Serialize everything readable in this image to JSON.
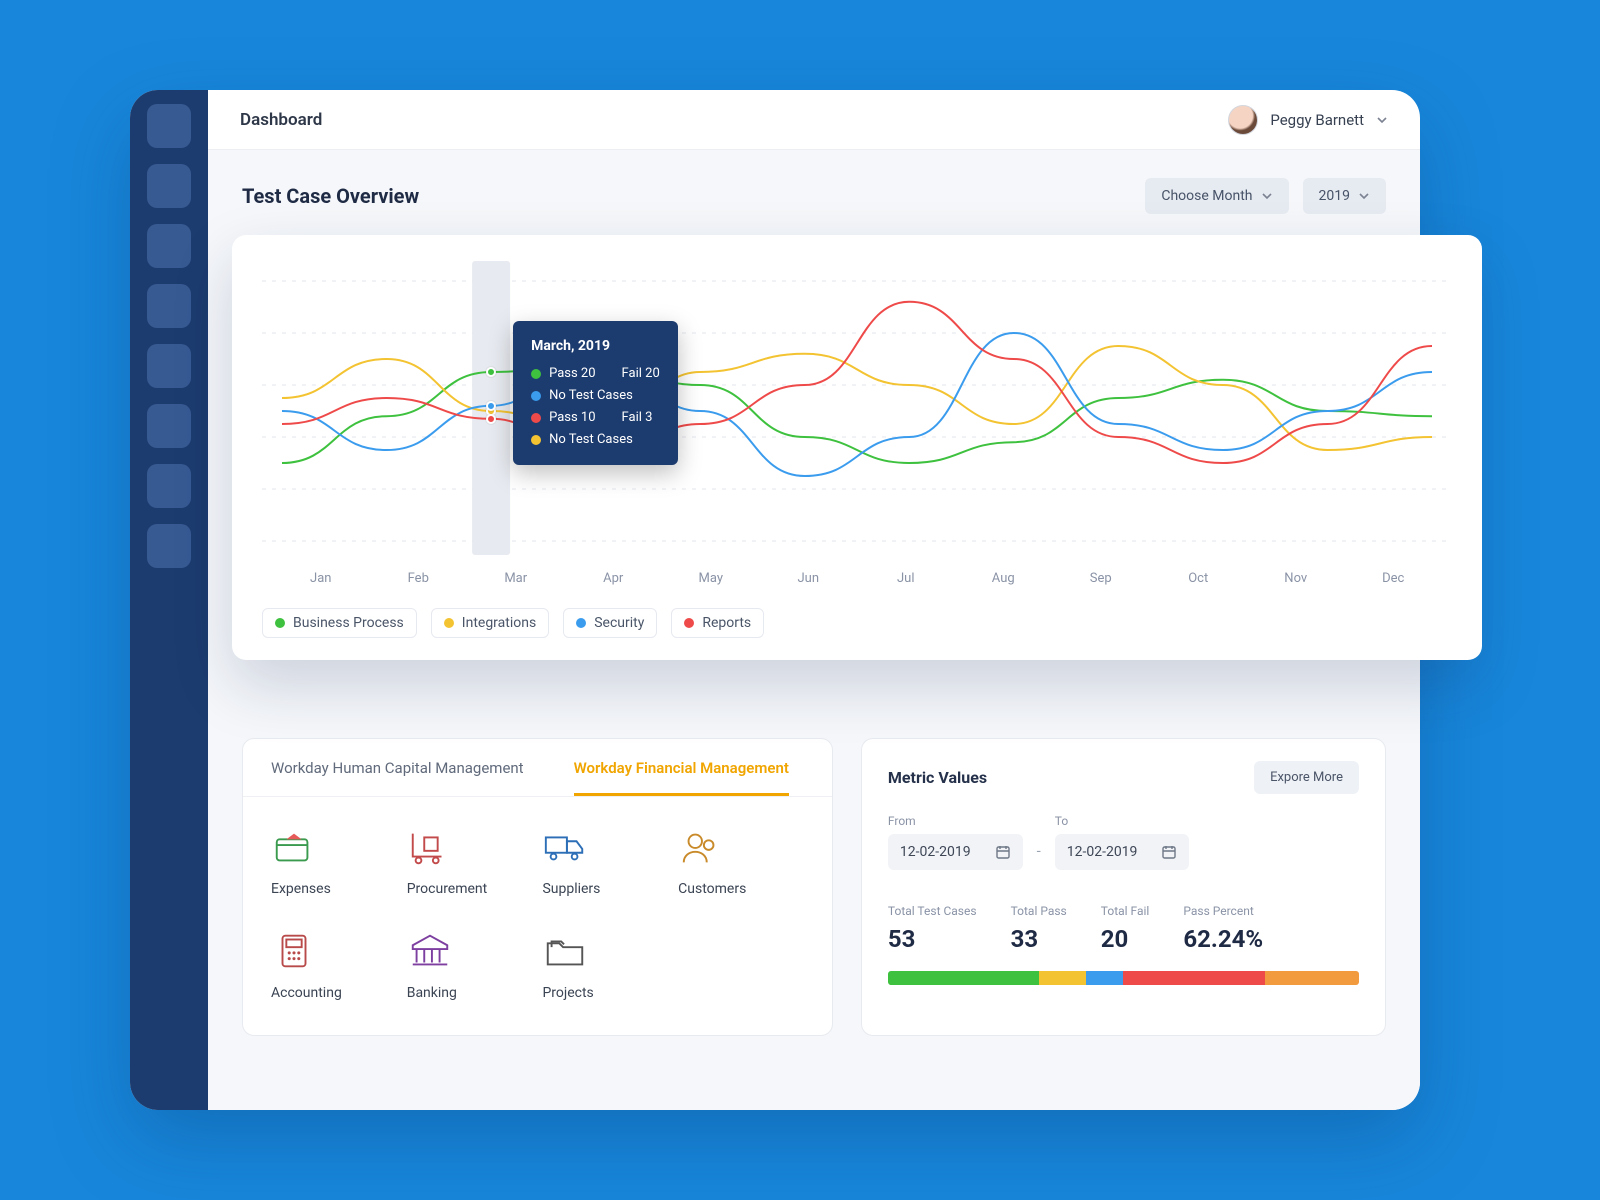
{
  "header": {
    "breadcrumb": "Dashboard",
    "user_name": "Peggy Barnett"
  },
  "overview": {
    "title": "Test Case Overview",
    "month_label": "Choose Month",
    "year_label": "2019"
  },
  "legend": [
    "Business Process",
    "Integrations",
    "Security",
    "Reports"
  ],
  "months": [
    "Jan",
    "Feb",
    "Mar",
    "Apr",
    "May",
    "Jun",
    "Jul",
    "Aug",
    "Sep",
    "Oct",
    "Nov",
    "Dec"
  ],
  "tooltip": {
    "title": "March, 2019",
    "rows": [
      {
        "color": "#3ec13e",
        "text": "Pass  20",
        "text2": "Fail  20"
      },
      {
        "color": "#3b9cee",
        "text": "No Test Cases",
        "text2": ""
      },
      {
        "color": "#ef4a4a",
        "text": "Pass  10",
        "text2": "Fail  3"
      },
      {
        "color": "#f3c332",
        "text": "No Test Cases",
        "text2": ""
      }
    ]
  },
  "tabs": {
    "items": [
      "Workday Human Capital Management",
      "Workday Financial Management"
    ],
    "active": 1
  },
  "tiles": [
    "Expenses",
    "Procurement",
    "Suppliers",
    "Customers",
    "Accounting",
    "Banking",
    "Projects"
  ],
  "metrics": {
    "title": "Metric Values",
    "more": "Expore More",
    "from_label": "From",
    "to_label": "To",
    "from": "12-02-2019",
    "to": "12-02-2019",
    "stats": {
      "total_cases_label": "Total Test Cases",
      "total_cases": "53",
      "total_pass_label": "Total Pass",
      "total_pass": "33",
      "total_fail_label": "Total Fail",
      "total_fail": "20",
      "pass_pct_label": "Pass Percent",
      "pass_pct": "62.24%"
    }
  },
  "chart_data": {
    "type": "line",
    "categories": [
      "Jan",
      "Feb",
      "Mar",
      "Apr",
      "May",
      "Jun",
      "Jul",
      "Aug",
      "Sep",
      "Oct",
      "Nov",
      "Dec"
    ],
    "ylim": [
      0,
      100
    ],
    "series": [
      {
        "name": "Business Process",
        "color": "#3ec13e",
        "values": [
          30,
          48,
          65,
          68,
          60,
          40,
          30,
          38,
          55,
          62,
          50,
          48
        ]
      },
      {
        "name": "Integrations",
        "color": "#f3c332",
        "values": [
          55,
          70,
          50,
          40,
          65,
          72,
          60,
          45,
          75,
          60,
          35,
          40
        ]
      },
      {
        "name": "Security",
        "color": "#3b9cee",
        "values": [
          50,
          35,
          52,
          72,
          50,
          25,
          40,
          80,
          45,
          35,
          50,
          65
        ]
      },
      {
        "name": "Reports",
        "color": "#ef4a4a",
        "values": [
          45,
          55,
          47,
          30,
          45,
          60,
          92,
          70,
          40,
          30,
          45,
          75
        ]
      }
    ],
    "highlight_index": 2,
    "legend_position": "bottom",
    "grid": true
  }
}
